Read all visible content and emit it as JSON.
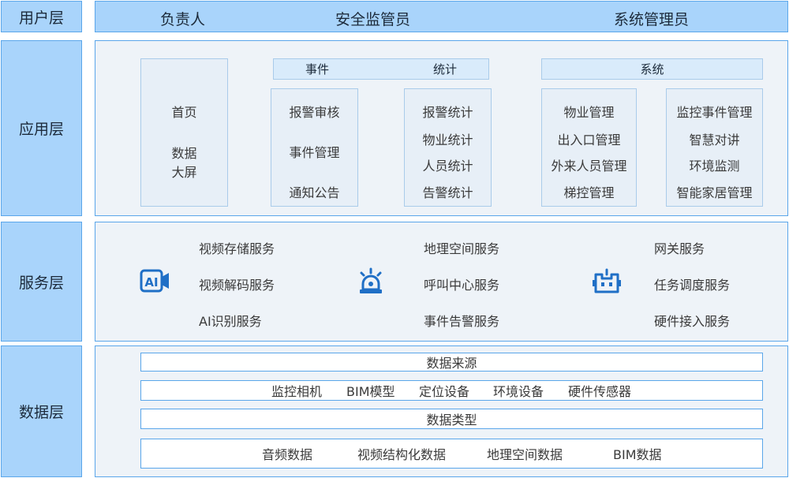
{
  "layers": {
    "user": "用户层",
    "app": "应用层",
    "service": "服务层",
    "data": "数据层"
  },
  "user_roles": [
    "负责人",
    "安全监管员",
    "系统管理员"
  ],
  "app": {
    "home_card": [
      "首页",
      "数据",
      "大屏"
    ],
    "event_header": [
      "事件",
      "统计"
    ],
    "event_items": [
      "报警审核",
      "事件管理",
      "通知公告"
    ],
    "stat_items": [
      "报警统计",
      "物业统计",
      "人员统计",
      "告警统计"
    ],
    "system_header": "系统",
    "system_left": [
      "物业管理",
      "出入口管理",
      "外来人员管理",
      "梯控管理"
    ],
    "system_right": [
      "监控事件管理",
      "智慧对讲",
      "环境监测",
      "智能家居管理"
    ]
  },
  "services": {
    "col1": [
      "视频存储服务",
      "视频解码服务",
      "AI识别服务"
    ],
    "col2": [
      "地理空间服务",
      "呼叫中心服务",
      "事件告警服务"
    ],
    "col3": [
      "网关服务",
      "任务调度服务",
      "硬件接入服务"
    ],
    "icons": [
      "ai-video-icon",
      "alarm-light-icon",
      "robot-icon"
    ],
    "ai_icon_text": "AI"
  },
  "data": {
    "source_title": "数据来源",
    "sources": [
      "监控相机",
      "BIM模型",
      "定位设备",
      "环境设备",
      "硬件传感器"
    ],
    "type_title": "数据类型",
    "types": [
      "音频数据",
      "视频结构化数据",
      "地理空间数据",
      "BIM数据"
    ]
  },
  "colors": {
    "label_bg": "#a9d4fb",
    "border": "#5aa6ea",
    "panel_bg": "#eef3f8",
    "icon_blue": "#1f6fc6"
  }
}
